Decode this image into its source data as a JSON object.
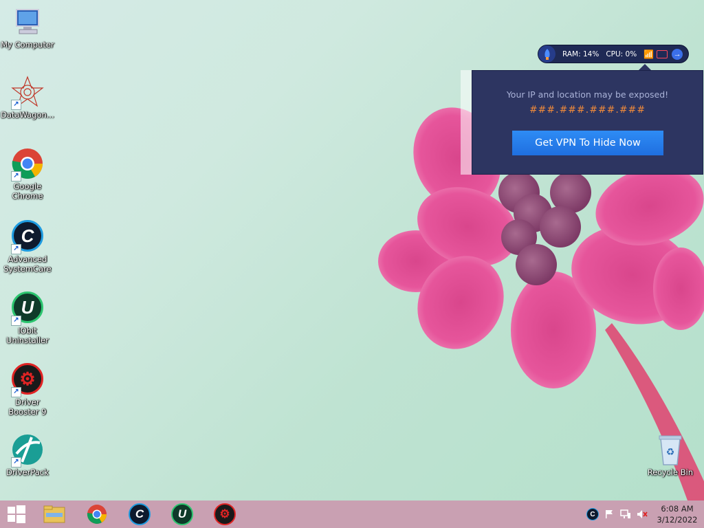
{
  "desktop_icons": [
    {
      "label": "My Computer"
    },
    {
      "label": "DataWagon..."
    },
    {
      "label": "Google Chrome"
    },
    {
      "label": "Advanced SystemCare"
    },
    {
      "label": "IObit Uninstaller"
    },
    {
      "label": "Driver Booster 9"
    },
    {
      "label": "DriverPack"
    },
    {
      "label": "Recycle Bin"
    }
  ],
  "monitor": {
    "ram": "RAM: 14%",
    "cpu": "CPU: 0%"
  },
  "popup": {
    "message": "Your IP and location may be exposed!",
    "ip": "###.###.###.###",
    "button": "Get VPN To Hide Now"
  },
  "clock": {
    "time": "6:08 AM",
    "date": "3/12/2022"
  },
  "colors": {
    "popup_bg": "#2d3561",
    "button": "#2e8cf5",
    "ip_text": "#f08a3a",
    "taskbar": "#c9a0b2"
  }
}
